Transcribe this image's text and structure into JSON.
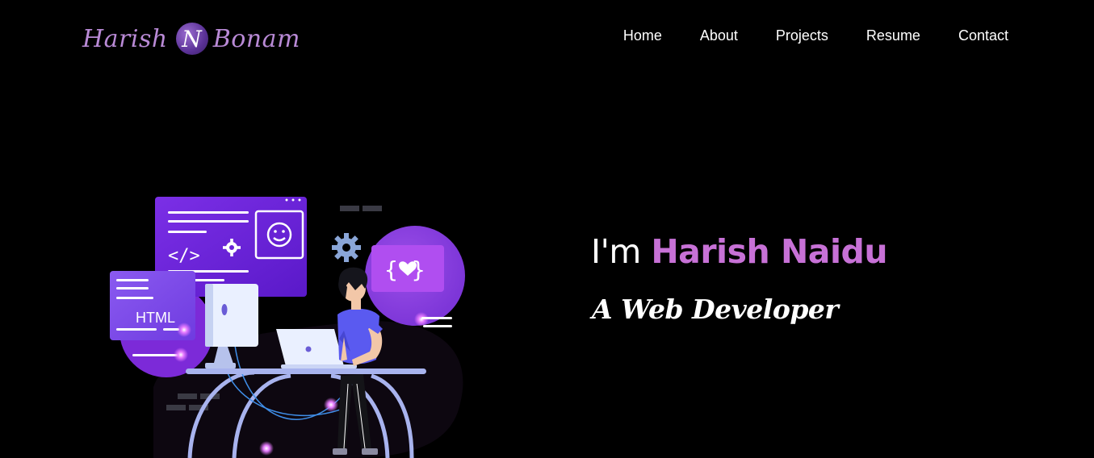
{
  "header": {
    "logo": {
      "first": "Harish",
      "initial": "N",
      "last": "Bonam"
    },
    "nav": [
      {
        "label": "Home"
      },
      {
        "label": "About"
      },
      {
        "label": "Projects"
      },
      {
        "label": "Resume"
      },
      {
        "label": "Contact"
      }
    ]
  },
  "hero": {
    "greeting": "I'm",
    "name": "Harish Naidu",
    "role": "A Web Developer",
    "illustration": {
      "html_label": "HTML",
      "code_icon": "</>",
      "braces_icon": "{ }",
      "icons": [
        "smiley-icon",
        "gear-icon",
        "heart-icon",
        "monitor-icon",
        "laptop-icon"
      ]
    }
  },
  "colors": {
    "background": "#000000",
    "accent": "#c771d6",
    "logo": "#b98ad6",
    "purple": "#7a2ce0"
  }
}
